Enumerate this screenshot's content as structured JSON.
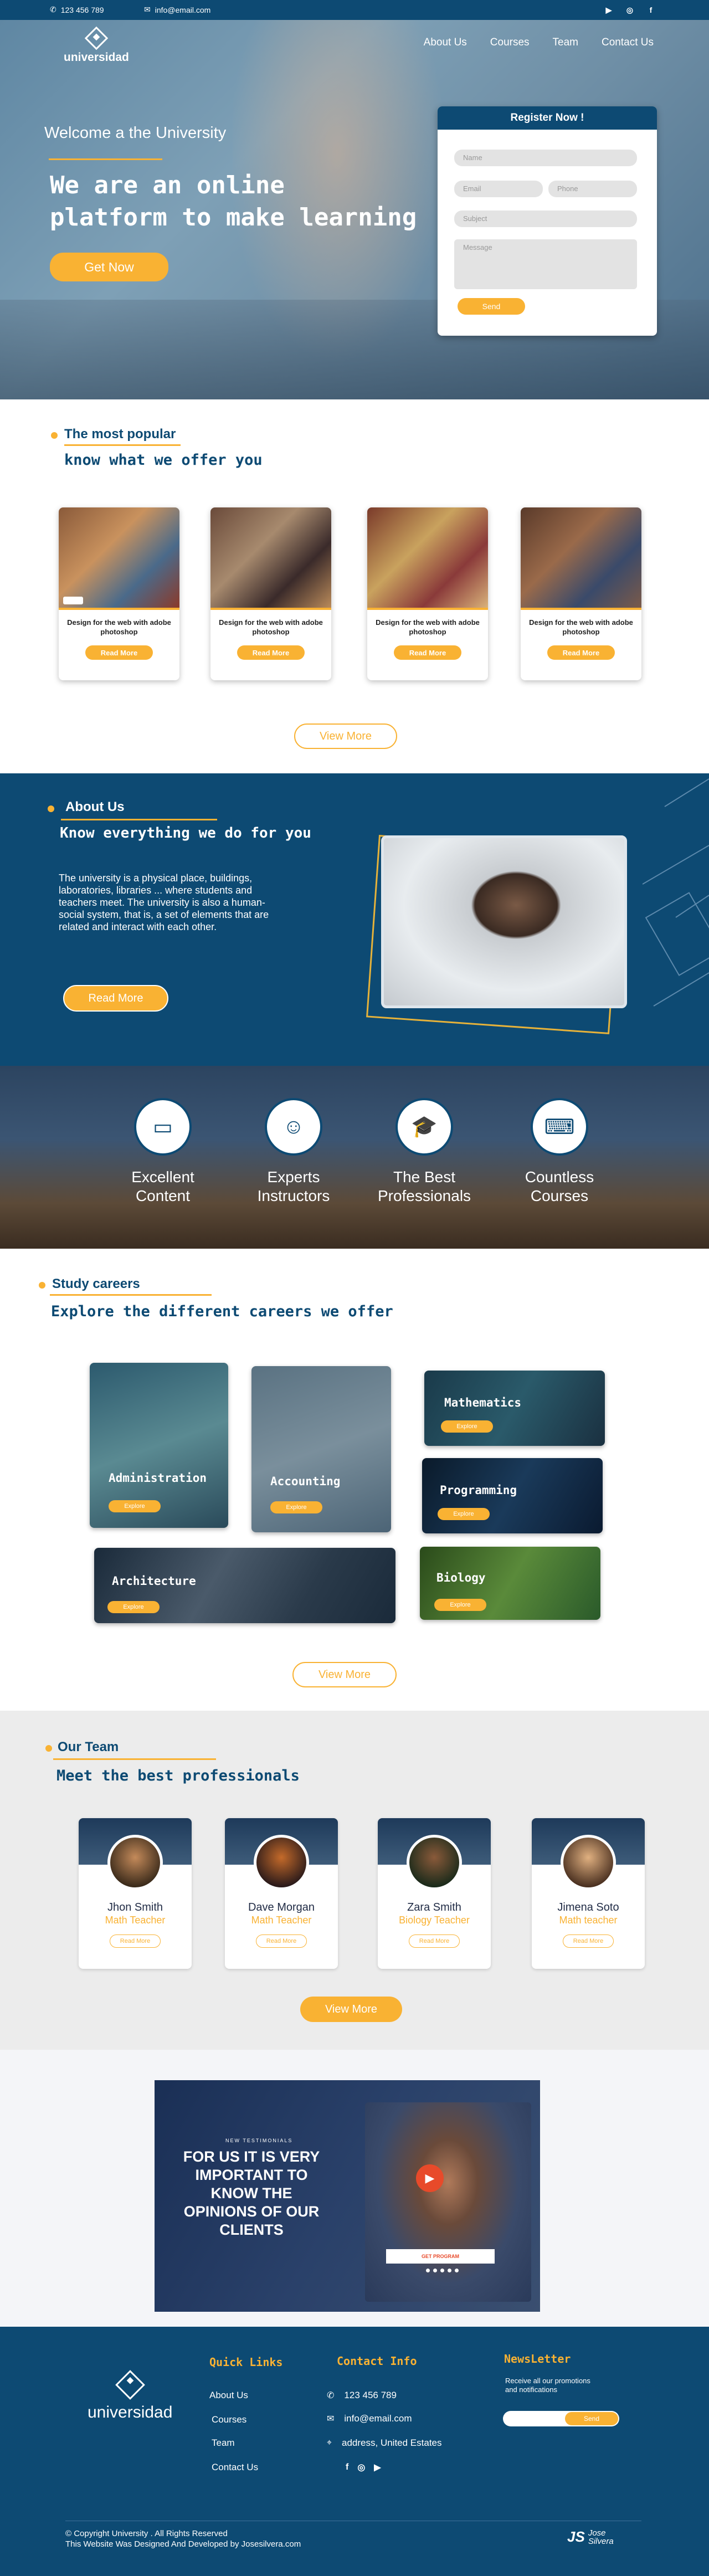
{
  "topbar": {
    "phone": "123 456 789",
    "email": "info@email.com"
  },
  "brand": {
    "name": "universidad"
  },
  "nav": [
    "About Us",
    "Courses",
    "Team",
    "Contact Us"
  ],
  "hero": {
    "welcome": "Welcome a the University",
    "headline1": "We are an online",
    "headline2": "platform to make learning",
    "cta": "Get Now"
  },
  "register": {
    "title": "Register Now !",
    "name": "Name",
    "email": "Email",
    "phone": "Phone",
    "subject": "Subject",
    "message": "Message",
    "submit": "Send"
  },
  "popular": {
    "kicker": "The most popular",
    "subtitle": "know what we offer you",
    "button": "View More",
    "cards": [
      {
        "title": "Design for the web with adobe photoshop",
        "button": "Read More"
      },
      {
        "title": "Design for the web with adobe photoshop",
        "button": "Read More"
      },
      {
        "title": "Design for the web with adobe photoshop",
        "button": "Read More"
      },
      {
        "title": "Design for the web with adobe photoshop",
        "button": "Read More"
      }
    ]
  },
  "about": {
    "kicker": "About Us",
    "subtitle": "Know everything we do for you",
    "body": "The university is a physical place, buildings, laboratories, libraries ... where students and teachers meet. The university is also a human-social system, that is, a set of elements that are related and interact with each other.",
    "button": "Read More"
  },
  "stats": [
    {
      "label1": "Excellent",
      "label2": "Content",
      "icon": "monitor-icon"
    },
    {
      "label1": "Experts",
      "label2": "Instructors",
      "icon": "instructor-icon"
    },
    {
      "label1": "The Best",
      "label2": "Professionals",
      "icon": "graduate-icon"
    },
    {
      "label1": "Countless",
      "label2": "Courses",
      "icon": "laptop-icon"
    }
  ],
  "careers": {
    "kicker": "Study careers",
    "subtitle": "Explore the different careers we offer",
    "button": "View More",
    "explore": "Explore",
    "items": [
      "Administration",
      "Accounting",
      "Mathematics",
      "Programming",
      "Architecture",
      "Biology"
    ]
  },
  "team": {
    "kicker": "Our Team",
    "subtitle": "Meet the best professionals",
    "button": "View More",
    "readmore": "Read More",
    "members": [
      {
        "name": "Jhon Smith",
        "role": "Math Teacher"
      },
      {
        "name": "Dave Morgan",
        "role": "Math Teacher"
      },
      {
        "name": "Zara Smith",
        "role": "Biology Teacher"
      },
      {
        "name": "Jimena Soto",
        "role": "Math teacher"
      }
    ]
  },
  "testimonial": {
    "small": "NEW TESTIMONIALS",
    "line1": "FOR US IT IS VERY",
    "line2": "IMPORTANT TO",
    "line3": "KNOW THE",
    "line4": "OPINIONS OF OUR",
    "line5": "CLIENTS",
    "button": "GET PROGRAM"
  },
  "footer": {
    "quick_title": "Quick Links",
    "links": [
      "About Us",
      "Courses",
      "Team",
      "Contact Us"
    ],
    "contact_title": "Contact Info",
    "phone": "123 456 789",
    "email": "info@email.com",
    "address": "address, United Estates",
    "news_title": "NewsLetter",
    "news_text1": "Receive all our promotions",
    "news_text2": "and notifications",
    "news_button": "Send",
    "copy1": "© Copyright  University . All Rights Reserved",
    "copy2": "This Website Was Designed And Developed by Josesilvera.com",
    "sig1": "Jose",
    "sig2": "Silvera"
  },
  "colors": {
    "primary": "#0d4a73",
    "accent": "#f9b233"
  }
}
